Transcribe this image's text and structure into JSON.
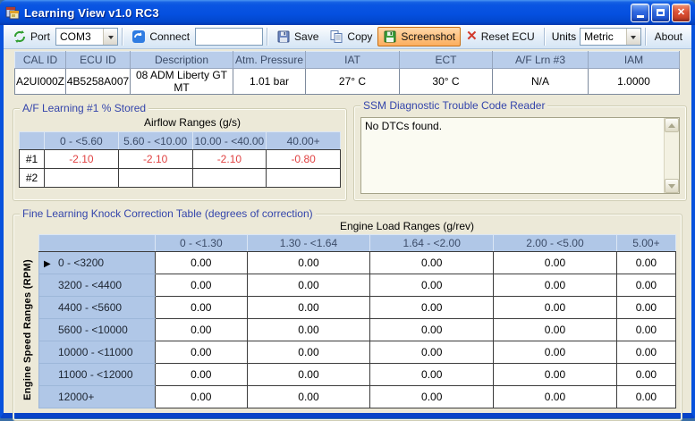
{
  "window": {
    "title": "Learning View v1.0 RC3"
  },
  "toolbar": {
    "port_label": "Port",
    "port_value": "COM3",
    "connect_label": "Connect",
    "connect_value": "",
    "save_label": "Save",
    "copy_label": "Copy",
    "screenshot_label": "Screenshot",
    "reset_label": "Reset ECU",
    "units_label": "Units",
    "units_value": "Metric",
    "about_label": "About",
    "reset_glyph": "✕"
  },
  "info": {
    "columns": [
      "CAL ID",
      "ECU ID",
      "Description",
      "Atm. Pressure",
      "IAT",
      "ECT",
      "A/F Lrn #3",
      "IAM"
    ],
    "values": [
      "A2UI000Z",
      "4B5258A007",
      "08 ADM Liberty GT MT",
      "1.01 bar",
      "27° C",
      "30° C",
      "N/A",
      "1.0000"
    ]
  },
  "af": {
    "title": "A/F Learning #1 % Stored",
    "subtitle": "Airflow Ranges (g/s)",
    "columns": [
      "0 - <5.60",
      "5.60 - <10.00",
      "10.00 - <40.00",
      "40.00+"
    ],
    "rows": [
      {
        "label": "#1",
        "values": [
          "-2.10",
          "-2.10",
          "-2.10",
          "-0.80"
        ]
      },
      {
        "label": "#2",
        "values": [
          "",
          "",
          "",
          ""
        ]
      }
    ],
    "value_color": "#e04343"
  },
  "dtc": {
    "title": "SSM Diagnostic Trouble Code Reader",
    "content": "No DTCs found."
  },
  "knock": {
    "title": "Fine Learning Knock Correction Table (degrees of correction)",
    "col_group": "Engine Load Ranges (g/rev)",
    "row_group": "Engine Speed Ranges (RPM)",
    "columns": [
      "0 - <1.30",
      "1.30 - <1.64",
      "1.64 - <2.00",
      "2.00 - <5.00",
      "5.00+"
    ],
    "rows": [
      {
        "label": "0 - <3200",
        "selected": true,
        "values": [
          "0.00",
          "0.00",
          "0.00",
          "0.00",
          "0.00"
        ]
      },
      {
        "label": "3200 - <4400",
        "selected": false,
        "values": [
          "0.00",
          "0.00",
          "0.00",
          "0.00",
          "0.00"
        ]
      },
      {
        "label": "4400 - <5600",
        "selected": false,
        "values": [
          "0.00",
          "0.00",
          "0.00",
          "0.00",
          "0.00"
        ]
      },
      {
        "label": "5600 - <10000",
        "selected": false,
        "values": [
          "0.00",
          "0.00",
          "0.00",
          "0.00",
          "0.00"
        ]
      },
      {
        "label": "10000 - <11000",
        "selected": false,
        "values": [
          "0.00",
          "0.00",
          "0.00",
          "0.00",
          "0.00"
        ]
      },
      {
        "label": "11000 - <12000",
        "selected": false,
        "values": [
          "0.00",
          "0.00",
          "0.00",
          "0.00",
          "0.00"
        ]
      },
      {
        "label": "12000+",
        "selected": false,
        "values": [
          "0.00",
          "0.00",
          "0.00",
          "0.00",
          "0.00"
        ]
      }
    ]
  },
  "colors": {
    "titlebar_blue": "#0550e0",
    "screenshot_highlight": "#fcae5e",
    "negative_value_red": "#e04343",
    "group_title_blue": "#3445ab",
    "grid_header_blue": "#b0c7e7"
  }
}
